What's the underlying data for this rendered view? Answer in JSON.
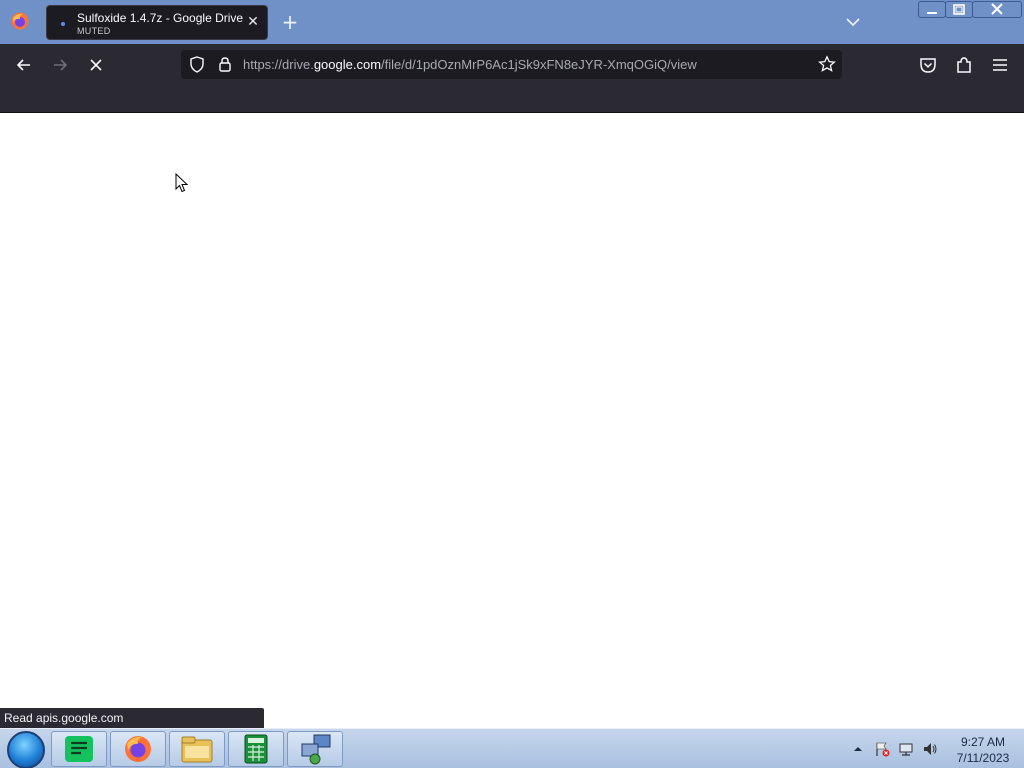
{
  "browser": {
    "tab": {
      "title": "Sulfoxide 1.4.7z - Google Drive",
      "subtitle": "MUTED"
    },
    "url": {
      "prefix": "https://drive.",
      "domain": "google.com",
      "path": "/file/d/1pdOznMrP6Ac1jSk9xFN8eJYR-XmqOGiQ/view"
    },
    "status_text": "Read apis.google.com"
  },
  "icons": {
    "browser_logo": "firefox-icon",
    "tab_favicon": "loading-dot-icon",
    "tab_close": "close-icon",
    "new_tab": "plus-icon",
    "tab_list": "chevron-down-icon",
    "back": "arrow-left-icon",
    "forward": "arrow-right-icon",
    "stop": "stop-icon",
    "shield": "shield-icon",
    "lock": "lock-icon",
    "bookmark_star": "star-icon",
    "pocket": "pocket-icon",
    "extensions": "puzzle-icon",
    "menu": "hamburger-icon"
  },
  "taskbar": {
    "clock_time": "9:27 AM",
    "clock_date": "7/11/2023",
    "pinned": [
      "notes-app-icon",
      "firefox-icon",
      "file-explorer-icon",
      "calculator-icon",
      "network-app-icon"
    ]
  },
  "colors": {
    "tabbar_bg": "#7091c8",
    "toolbar_bg": "#2b2a33",
    "urlbar_bg": "#1c1b22",
    "content_bg": "#ffffff"
  }
}
